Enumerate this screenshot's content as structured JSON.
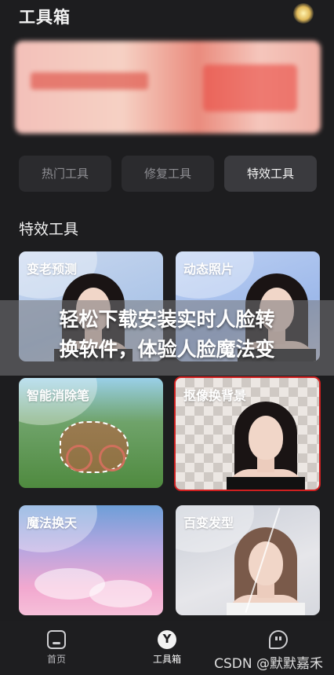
{
  "header": {
    "title": "工具箱",
    "corner_icon": "sparkle-icon"
  },
  "banner": {
    "blurred": true
  },
  "tabs": [
    {
      "label": "热门工具",
      "active": false
    },
    {
      "label": "修复工具",
      "active": false
    },
    {
      "label": "特效工具",
      "active": true
    }
  ],
  "section": {
    "title": "特效工具"
  },
  "cards": [
    {
      "label": "变老预测"
    },
    {
      "label": "动态照片"
    },
    {
      "label": "智能消除笔"
    },
    {
      "label": "抠像换背景",
      "selected": true
    },
    {
      "label": "魔法换天"
    },
    {
      "label": "百变发型"
    }
  ],
  "overlay": {
    "text": "轻松下载安装实时人脸转\n换软件，体验人脸魔法变"
  },
  "bottom_nav": [
    {
      "label": "首页",
      "icon": "home-icon",
      "active": false
    },
    {
      "label": "工具箱",
      "icon": "toolbox-icon",
      "active": true
    },
    {
      "label": "",
      "icon": "message-icon",
      "active": false
    }
  ],
  "watermark": "CSDN @默默嘉禾",
  "colors": {
    "background": "#1d1d1f",
    "selected_border": "#d02020"
  }
}
